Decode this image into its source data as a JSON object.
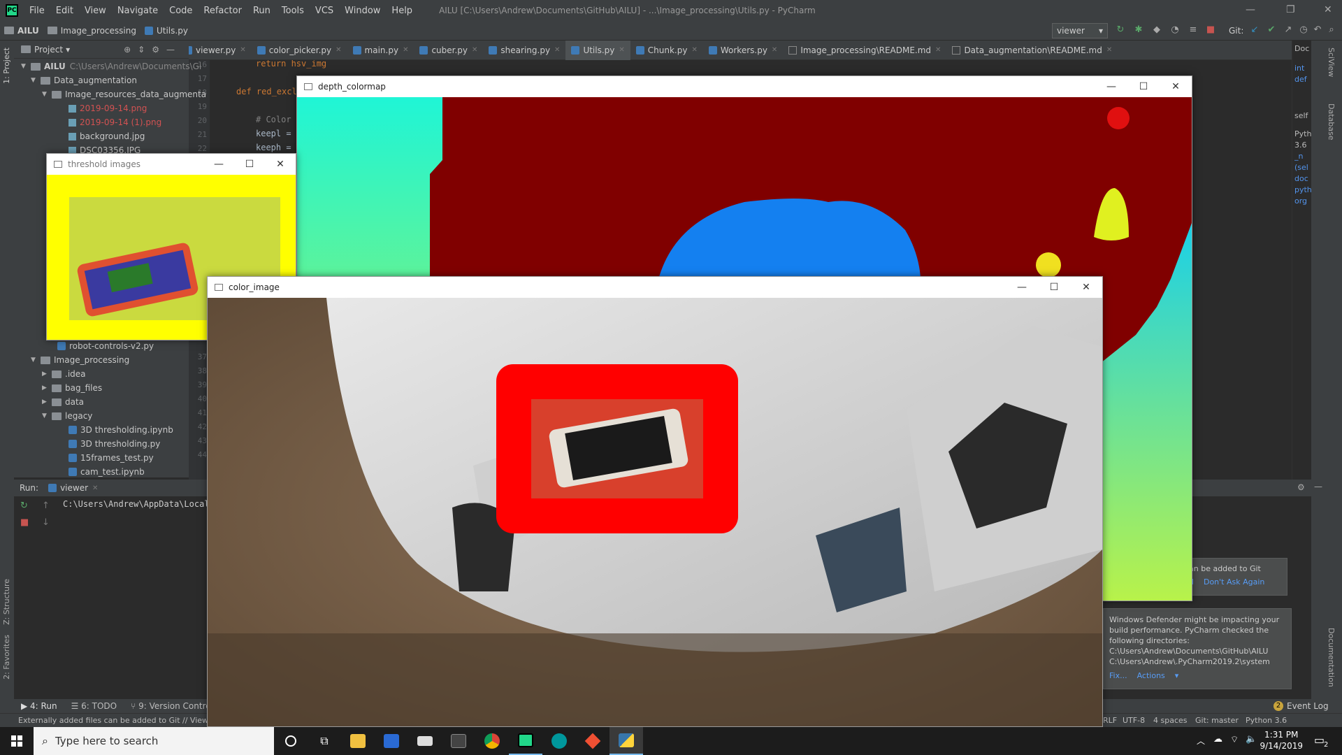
{
  "titlebar": {
    "menus": [
      "File",
      "Edit",
      "View",
      "Navigate",
      "Code",
      "Refactor",
      "Run",
      "Tools",
      "VCS",
      "Window",
      "Help"
    ],
    "title": "AILU [C:\\Users\\Andrew\\Documents\\GitHub\\AILU] - ...\\Image_processing\\Utils.py - PyCharm"
  },
  "navbar": {
    "crumbs": [
      "AILU",
      "Image_processing",
      "Utils.py"
    ],
    "run_config": "viewer",
    "git_label": "Git:"
  },
  "tabs": [
    "viewer.py",
    "color_picker.py",
    "main.py",
    "cuber.py",
    "shearing.py",
    "Utils.py",
    "Chunk.py",
    "Workers.py",
    "Image_processing\\README.md",
    "Data_augmentation\\README.md"
  ],
  "active_tab": "Utils.py",
  "project": {
    "header": "Project",
    "root_name": "AILU",
    "root_path": "C:\\Users\\Andrew\\Documents\\Gi",
    "top_items": [
      "Data_augmentation",
      "Image_resources_data_augmenta",
      "2019-09-14.png",
      "2019-09-14 (1).png",
      "background.jpg",
      "DSC03356.JPG"
    ],
    "bottom_items": [
      "robot-controls-v2.py",
      "Image_processing",
      ".idea",
      "bag_files",
      "data",
      "legacy",
      "3D thresholding.ipynb",
      "3D thresholding.py",
      "15frames_test.py",
      "cam_test.ipynb"
    ]
  },
  "editor": {
    "line_numbers": [
      "16",
      "17",
      "18",
      "19",
      "20",
      "21",
      "22"
    ],
    "lower_line_numbers": [
      "37",
      "38",
      "39",
      "40",
      "41",
      "42",
      "43",
      "44"
    ],
    "lines": [
      "return hsv_img",
      "",
      "def red_excl",
      "",
      "# Color",
      "keepl =",
      "keeph ="
    ]
  },
  "doc_panel": [
    "Doc",
    "int",
    "def",
    "self",
    "Pyth",
    "3.6",
    "_n",
    "(sel",
    "doc",
    "pyth",
    "org"
  ],
  "run": {
    "label": "Run:",
    "tab": "viewer",
    "path": "C:\\Users\\Andrew\\AppData\\Local"
  },
  "notifications": {
    "git": "an be added to Git",
    "git_link_a": "d",
    "git_link_b": "Don't Ask Again",
    "defender": "Windows Defender might be impacting your build performance. PyCharm checked the following directories:",
    "dir1": "C:\\Users\\Andrew\\Documents\\GitHub\\AILU",
    "dir2": "C:\\Users\\Andrew\\.PyCharm2019.2\\system",
    "fix": "Fix...",
    "actions": "Actions"
  },
  "bottom_tools": [
    "4: Run",
    "6: TODO",
    "9: Version Control"
  ],
  "event_log": "Event Log",
  "event_count": "2",
  "statusbar": {
    "message": "Externally added files can be added to Git // View F",
    "crlf": "RLF",
    "encoding": "UTF-8",
    "indent": "4 spaces",
    "git": "Git: master",
    "python": "Python 3.6"
  },
  "side_labels": {
    "project": "1: Project",
    "structure": "Z: Structure",
    "favorites": "2: Favorites",
    "sciview": "SciView",
    "database": "Database",
    "documentation": "Documentation"
  },
  "windows": {
    "depth": "depth_colormap",
    "threshold": "threshold images",
    "color": "color_image"
  },
  "taskbar": {
    "search_placeholder": "Type here to search",
    "time": "1:31 PM",
    "date": "9/14/2019",
    "notif_count": "2"
  }
}
